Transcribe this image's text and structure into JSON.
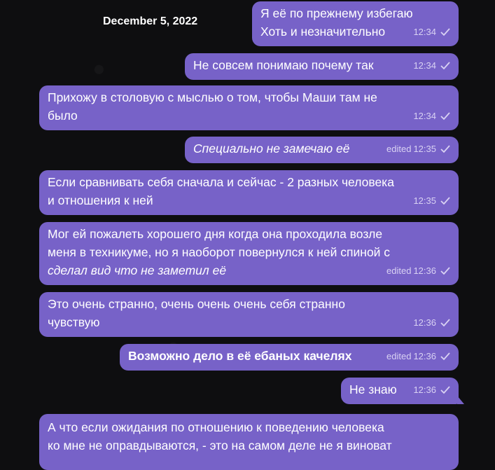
{
  "date_header": "December 5, 2022",
  "messages": [
    {
      "lines": "Я её по прежнему избегаю\nХоть и незначительно",
      "time": "12:34",
      "edited": ""
    },
    {
      "lines": "Не совсем понимаю почему так",
      "time": "12:34",
      "edited": ""
    },
    {
      "lines": "Прихожу в столовую с мыслью о том, чтобы Маши там не\nбыло",
      "time": "12:34",
      "edited": ""
    },
    {
      "lines": "Специально не замечаю её",
      "time": "12:35",
      "edited": "edited"
    },
    {
      "lines": "Если сравнивать себя сначала и сейчас - 2 разных человека\nи отношения к ней",
      "time": "12:35",
      "edited": ""
    },
    {
      "lines": "Мог ей пожалеть хорошего дня когда она проходила возле\nменя в техникуме, но я наоборот повернулся к ней спиной с",
      "italic_line": "сделал вид что не заметил её",
      "time": "12:36",
      "edited": "edited"
    },
    {
      "lines": "Это очень странно, очень очень очень себя странно\nчувствую",
      "time": "12:36",
      "edited": ""
    },
    {
      "lines": "Возможно дело в её ебаных качелях",
      "time": "12:36",
      "edited": "edited"
    },
    {
      "lines": "Не знаю",
      "time": "12:36",
      "edited": ""
    },
    {
      "lines": "А что если ожидания по отношению к поведению человека\nко мне не оправдываются, - это на самом деле не я виноват",
      "time": "",
      "edited": ""
    }
  ],
  "colors": {
    "bubble": "#7762c8",
    "background": "#0e0e10",
    "meta": "#d9d2f3"
  },
  "icons": {
    "read_status": "check-icon"
  }
}
